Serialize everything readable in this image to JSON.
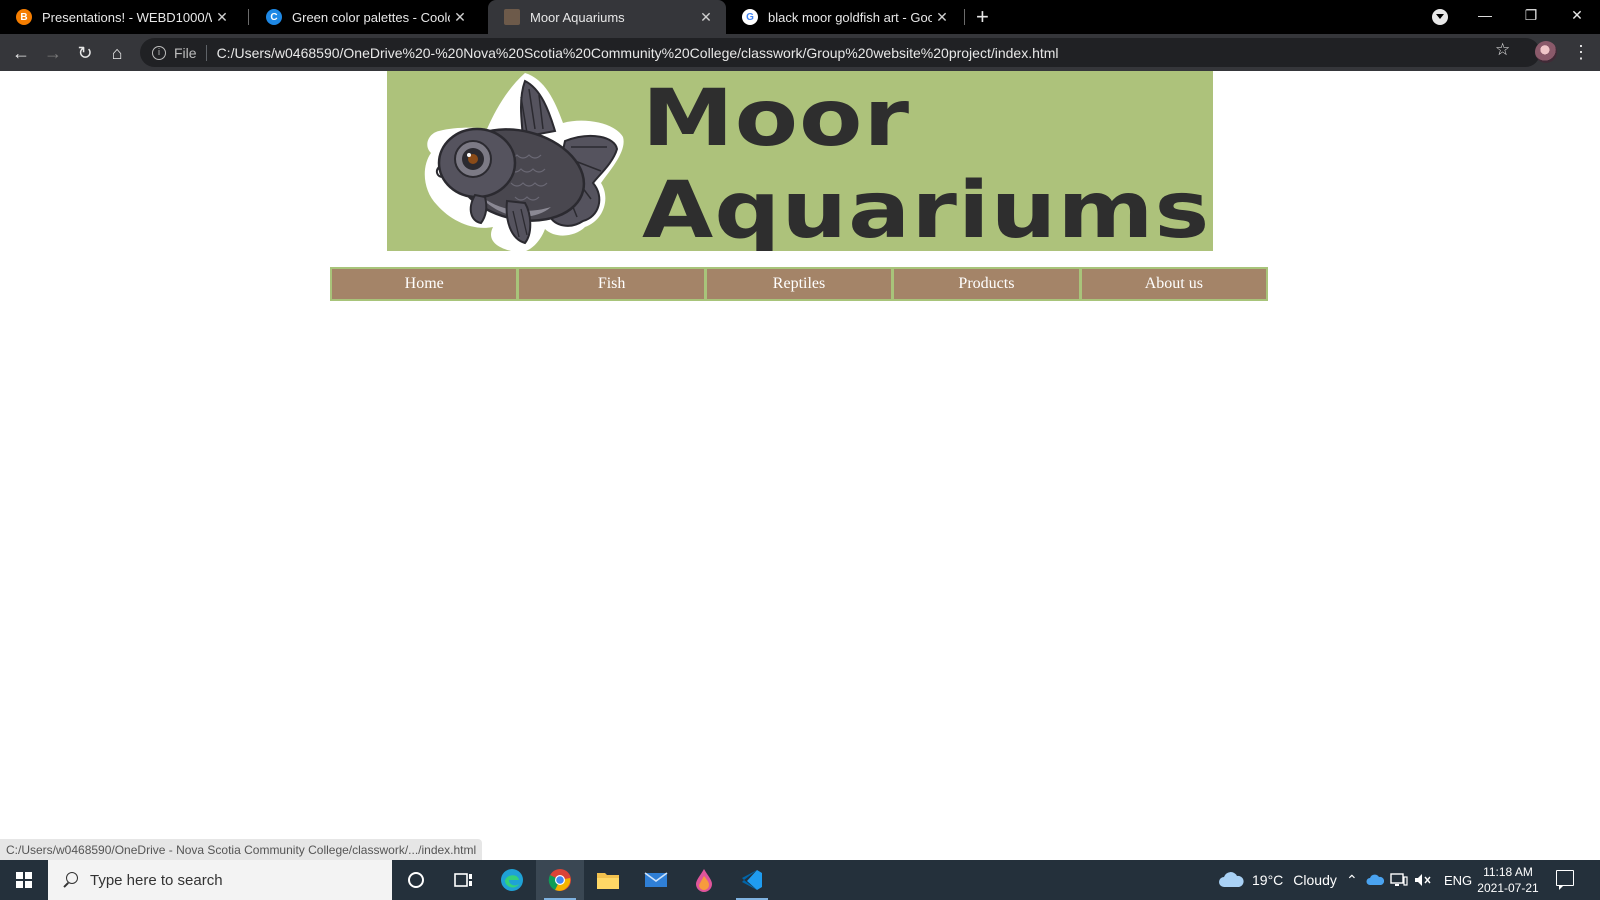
{
  "browser": {
    "tabs": [
      {
        "title": "Presentations! - WEBD1000/Web",
        "favicon": "blogger-icon",
        "active": false
      },
      {
        "title": "Green color palettes - Coolors",
        "favicon": "coolors-icon",
        "active": false
      },
      {
        "title": "Moor Aquariums",
        "favicon": "page-thumbnail-icon",
        "active": true
      },
      {
        "title": "black moor goldfish art - Google",
        "favicon": "google-icon",
        "active": false
      }
    ],
    "omnibox": {
      "scheme_label": "File",
      "url": "C:/Users/w0468590/OneDrive%20-%20Nova%20Scotia%20Community%20College/classwork/Group%20website%20project/index.html"
    },
    "status_url": "C:/Users/w0468590/OneDrive - Nova Scotia Community College/classwork/.../index.html"
  },
  "page": {
    "banner": {
      "title_line1": "Moor",
      "title_line2": "Aquariums",
      "background_color": "#adc27b"
    },
    "nav": [
      {
        "label": "Home"
      },
      {
        "label": "Fish"
      },
      {
        "label": "Reptiles"
      },
      {
        "label": "Products"
      },
      {
        "label": "About us"
      }
    ],
    "nav_colors": {
      "button": "#a48468",
      "border": "#a8c47a"
    }
  },
  "taskbar": {
    "search_placeholder": "Type here to search",
    "apps": [
      "cortana-icon",
      "task-view-icon",
      "edge-icon",
      "chrome-icon",
      "file-explorer-icon",
      "mail-icon",
      "color-app-icon",
      "vscode-icon"
    ],
    "weather": {
      "temp": "19°C",
      "condition": "Cloudy"
    },
    "language": "ENG",
    "time": "11:18 AM",
    "date": "2021-07-21"
  }
}
